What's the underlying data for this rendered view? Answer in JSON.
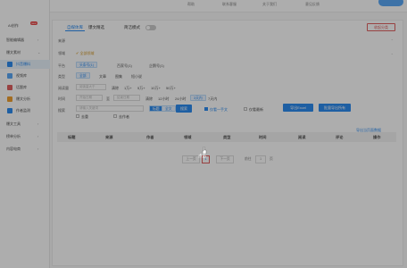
{
  "topbar": {
    "links": [
      "帮助",
      "联系客服",
      "关于我们",
      "意见反馈"
    ]
  },
  "sidebar": {
    "badge": "new",
    "items": [
      {
        "label": "AI创作"
      },
      {
        "label": "智能编辑器"
      },
      {
        "label": "爆文素材"
      },
      {
        "label": "抖音爆料"
      },
      {
        "label": "视频库"
      },
      {
        "label": "话题库"
      },
      {
        "label": "爆文分析"
      },
      {
        "label": "作者监测"
      },
      {
        "label": "爆文工具"
      },
      {
        "label": "榜单分析"
      },
      {
        "label": "内容电商"
      }
    ]
  },
  "panel": {
    "tabs": [
      "自媒体库",
      "爆文精选",
      "简洁模式"
    ],
    "action_button": "收起分类",
    "rows": {
      "source": "来源",
      "domain": "领域",
      "domain_chip": "✔ 全部领域",
      "platform": "平台",
      "platform_opts": [
        "头条号(1)",
        "百家号(1)",
        "企鹅号(1)"
      ],
      "type": "类型",
      "type_opts": [
        "全部",
        "文章",
        "图集",
        "短小说"
      ],
      "reads": "阅读量",
      "reads_placeholder": "阅读量大于",
      "reads_opts": [
        "清除",
        "1万+",
        "5万+",
        "10万+",
        "50万+"
      ],
      "time": "时间",
      "start_placeholder": "开始日期",
      "time_sep": "至",
      "end_placeholder": "结束日期",
      "time_opts": [
        "清除",
        "12小时",
        "24小时",
        "3天内",
        "7天内"
      ],
      "search": "搜索",
      "search_placeholder": "请输入关键词",
      "title_chip": "标题",
      "content_chip": "全文",
      "search_btn": "搜索",
      "opt_original": "仅看一手文",
      "opt_recent": "仅看最新",
      "export_btn": "导出Excel",
      "export_all_btn": "批量导出所有",
      "opt_dedupe": "去重",
      "opt_author": "去作者"
    },
    "export_link": "导出当页面数据",
    "columns": [
      "标题",
      "来源",
      "作者",
      "领域",
      "类型",
      "时间",
      "阅读",
      "评论",
      "操作"
    ],
    "pagination": {
      "prev": "上一页",
      "page": "1",
      "next": "下一页",
      "goto": "前往",
      "goto_value": "1",
      "suffix": "页"
    }
  },
  "cursor_label": "点击"
}
